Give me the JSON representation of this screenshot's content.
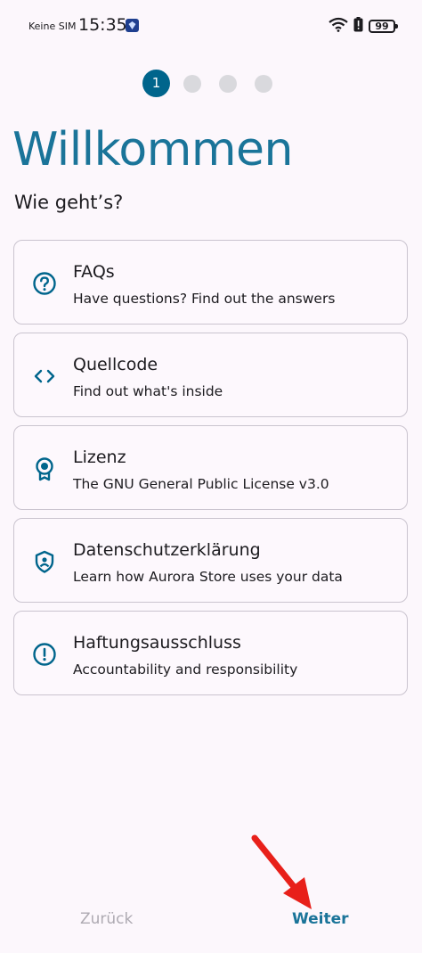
{
  "status_bar": {
    "carrier": "Keine SIM",
    "time": "15:35",
    "battery": "99"
  },
  "stepper": {
    "current": "1"
  },
  "header": {
    "title": "Willkommen",
    "subtitle": "Wie geht’s?"
  },
  "cards": [
    {
      "title": "FAQs",
      "description": "Have questions? Find out the answers",
      "icon": "help-circle-icon"
    },
    {
      "title": "Quellcode",
      "description": "Find out what's inside",
      "icon": "code-icon"
    },
    {
      "title": "Lizenz",
      "description": "The GNU General Public License v3.0",
      "icon": "license-badge-icon"
    },
    {
      "title": "Datenschutzerklärung",
      "description": "Learn how Aurora Store uses your data",
      "icon": "privacy-shield-icon"
    },
    {
      "title": "Haftungsausschluss",
      "description": "Accountability and responsibility",
      "icon": "alert-circle-icon"
    }
  ],
  "navigation": {
    "back_label": "Zurück",
    "next_label": "Weiter"
  },
  "colors": {
    "accent": "#00658C",
    "title": "#1A7499",
    "annotation_arrow": "#E8201A"
  }
}
